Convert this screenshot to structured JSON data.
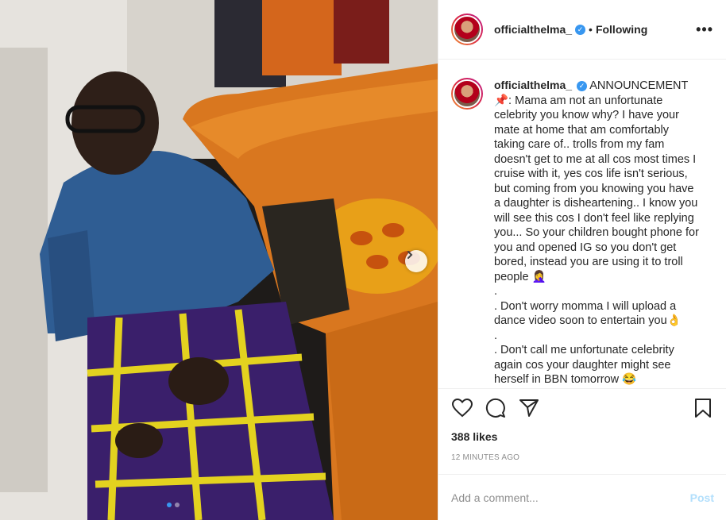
{
  "post": {
    "username": "officialthelma_",
    "verified_icon": "verified-badge-icon",
    "separator": "•",
    "follow_status": "Following",
    "more_label": "•••"
  },
  "caption": {
    "username": "officialthelma_",
    "text": "ANNOUNCEMENT\n📌: Mama am not an unfortunate celebrity you know why? I have your mate at home that am comfortably taking care of.. trolls from my fam doesn't get to me at all cos most times I cruise with it, yes cos life isn't serious, but coming from you knowing you have a daughter is disheartening.. I know you will see this cos I don't feel like replying you... So your children bought phone for you and opened IG so you don't get bored, instead you are using it to troll people 🤦‍♀️\n.\n. Don't worry momma I will upload a dance video soon to entertain you👌\n.\n. Don't call me unfortunate celebrity again cos your daughter might see herself in BBN tomorrow 😂"
  },
  "actions": {
    "like_icon": "heart-icon",
    "comment_icon": "comment-icon",
    "share_icon": "share-icon",
    "save_icon": "bookmark-icon"
  },
  "stats": {
    "likes": "388 likes",
    "time": "12 MINUTES AGO"
  },
  "comment": {
    "placeholder": "Add a comment...",
    "post_label": "Post"
  },
  "carousel": {
    "next_icon": "chevron-right-icon",
    "slide_count": 2,
    "active_slide": 0
  },
  "colors": {
    "accent": "#3897f0",
    "post_disabled": "#b2dffc",
    "secondary_text": "#8e8e8e"
  }
}
